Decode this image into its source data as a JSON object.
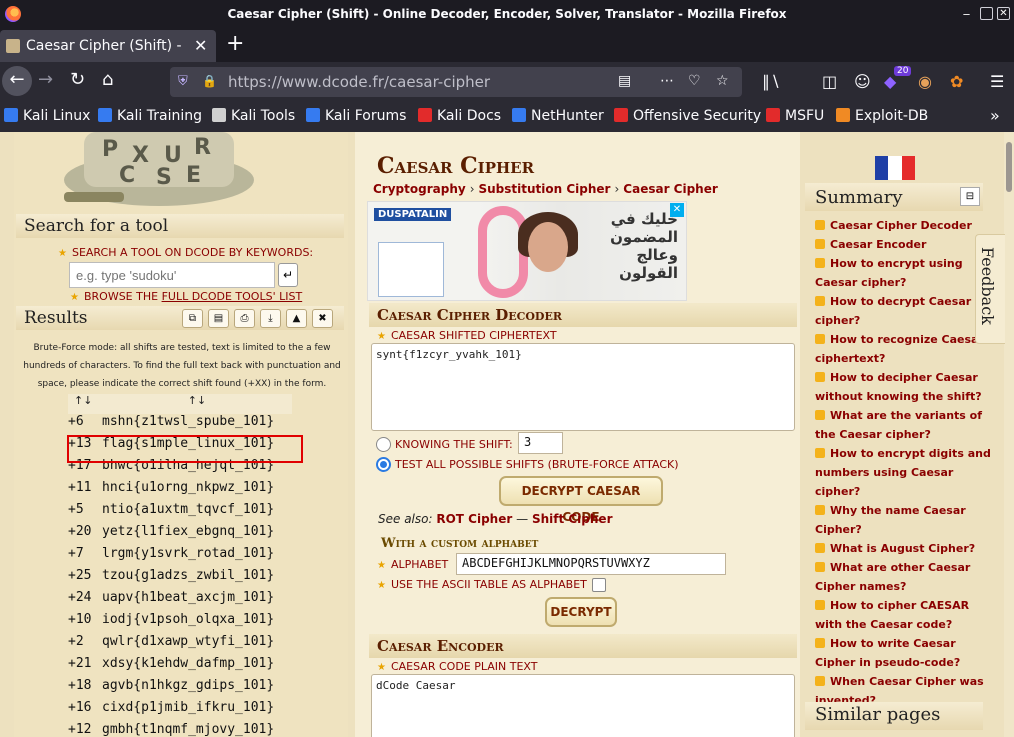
{
  "window": {
    "title": "Caesar Cipher (Shift) - Online Decoder, Encoder, Solver, Translator - Mozilla Firefox",
    "minimize_glyph": "_",
    "maximize_glyph": "▢",
    "close_glyph": "✕"
  },
  "tab": {
    "title": "Caesar Cipher (Shift) - Or",
    "close_glyph": "✕",
    "new_tab_glyph": "+"
  },
  "nav": {
    "url_host": "https://www.dcode.fr",
    "url_path": "/caesar-cipher",
    "extension_badge": "20"
  },
  "bookmarks": [
    {
      "label": "Kali Linux",
      "icon": "kali-icon",
      "color": "#367bf0"
    },
    {
      "label": "Kali Training",
      "icon": "kali-training-icon",
      "color": "#367bf0"
    },
    {
      "label": "Kali Tools",
      "icon": "kali-tools-icon",
      "color": "#d0d0d0"
    },
    {
      "label": "Kali Forums",
      "icon": "kali-forums-icon",
      "color": "#367bf0"
    },
    {
      "label": "Kali Docs",
      "icon": "kali-docs-icon",
      "color": "#e22b2b"
    },
    {
      "label": "NetHunter",
      "icon": "nethunter-icon",
      "color": "#367bf0"
    },
    {
      "label": "Offensive Security",
      "icon": "offsec-icon",
      "color": "#e22b2b"
    },
    {
      "label": "MSFU",
      "icon": "msfu-icon",
      "color": "#e22b2b"
    },
    {
      "label": "Exploit-DB",
      "icon": "exploitdb-icon",
      "color": "#f08a24"
    }
  ],
  "left": {
    "search_heading": "Search for a tool",
    "search_label": "SEARCH A TOOL ON DCODE BY KEYWORDS:",
    "search_placeholder": "e.g. type 'sudoku'",
    "browse_prefix": "BROWSE THE ",
    "browse_link": "FULL DCODE TOOLS' LIST",
    "results_heading": "Results",
    "bruteforce_note": "Brute-Force mode: all shifts are tested, text is limited to the a few hundreds of characters. To find the full text back with punctuation and space, please indicate the correct shift found (+XX) in the form.",
    "col_shift_sort": "↑↓",
    "col_text_sort": "↑↓",
    "results": [
      {
        "shift": "+6",
        "text": "mshn{z1twsl_spube_101}"
      },
      {
        "shift": "+13",
        "text": "flag{s1mple_linux_101}"
      },
      {
        "shift": "+17",
        "text": "bhwc{o1ilha_hejqt_101}"
      },
      {
        "shift": "+11",
        "text": "hnci{u1orng_nkpwz_101}"
      },
      {
        "shift": "+5",
        "text": "ntio{a1uxtm_tqvcf_101}"
      },
      {
        "shift": "+20",
        "text": "yetz{l1fiex_ebgnq_101}"
      },
      {
        "shift": "+7",
        "text": "lrgm{y1svrk_rotad_101}"
      },
      {
        "shift": "+25",
        "text": "tzou{g1adzs_zwbil_101}"
      },
      {
        "shift": "+24",
        "text": "uapv{h1beat_axcjm_101}"
      },
      {
        "shift": "+10",
        "text": "iodj{v1psoh_olqxa_101}"
      },
      {
        "shift": "+2",
        "text": "qwlr{d1xawp_wtyfi_101}"
      },
      {
        "shift": "+21",
        "text": "xdsy{k1ehdw_dafmp_101}"
      },
      {
        "shift": "+18",
        "text": "agvb{n1hkgz_gdips_101}"
      },
      {
        "shift": "+16",
        "text": "cixd{p1jmib_ifkru_101}"
      },
      {
        "shift": "+12",
        "text": "gmbh{t1nqmf_mjovy_101}"
      }
    ]
  },
  "center": {
    "title": "Caesar Cipher",
    "breadcrumbs": [
      "Cryptography",
      "Substitution Cipher",
      "Caesar Cipher"
    ],
    "crumb_sep": "›",
    "ad": {
      "brand": "DUSPATALIN",
      "arabic": "خليك في المضمون وعالج القولون",
      "close": "✕"
    },
    "decoder": {
      "heading": "Caesar Cipher Decoder",
      "ciphertext_label": "CAESAR SHIFTED CIPHERTEXT",
      "ciphertext_value": "synt{f1zcyr_yvahk_101}",
      "knowing_shift_label": "KNOWING THE SHIFT:",
      "shift_value": "3",
      "bruteforce_label": "TEST ALL POSSIBLE SHIFTS (BRUTE-FORCE ATTACK)",
      "decrypt_button": "DECRYPT CAESAR CODE",
      "see_also_prefix": "See also:",
      "see_also_rot": "ROT Cipher",
      "see_also_dash": "—",
      "see_also_shift": "Shift Cipher",
      "custom_alpha_heading": "With a custom alphabet",
      "alphabet_label": "ALPHABET",
      "alphabet_value": "ABCDEFGHIJKLMNOPQRSTUVWXYZ",
      "ascii_label": "USE THE ASCII TABLE AS ALPHABET",
      "decrypt2_button": "DECRYPT"
    },
    "encoder": {
      "heading": "Caesar Encoder",
      "plaintext_label": "CAESAR CODE PLAIN TEXT",
      "plaintext_value": "dCode Caesar"
    }
  },
  "right": {
    "summary_heading": "Summary",
    "collapse_glyph": "⊟",
    "summary_items": [
      "Caesar Cipher Decoder",
      "Caesar Encoder",
      "How to encrypt using Caesar cipher?",
      "How to decrypt Caesar cipher?",
      "How to recognize Caesar ciphertext?",
      "How to decipher Caesar without knowing the shift?",
      "What are the variants of the Caesar cipher?",
      "How to encrypt digits and numbers using Caesar cipher?",
      "Why the name Caesar Cipher?",
      "What is August Cipher?",
      "What are other Caesar Cipher names?",
      "How to cipher CAESAR with the Caesar code?",
      "How to write Caesar Cipher in pseudo-code?",
      "When Caesar Cipher was invented?"
    ],
    "similar_heading": "Similar pages",
    "feedback": "Feedback",
    "flag_colors": [
      "#1f3fa6",
      "#ffffff",
      "#e52b2b"
    ]
  }
}
